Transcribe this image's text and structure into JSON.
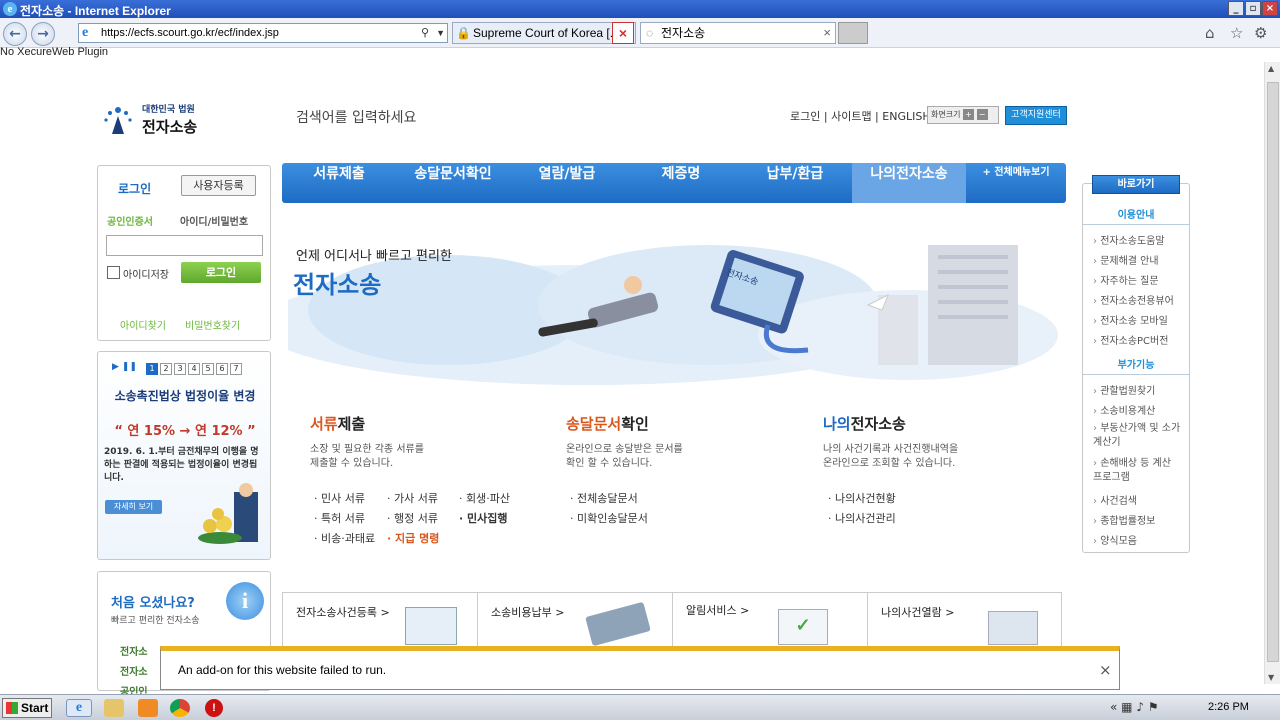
{
  "window": {
    "title": "전자소송 - Internet Explorer"
  },
  "browser": {
    "url": "https://ecfs.scourt.go.kr/ecf/index.jsp",
    "tabs": [
      {
        "label": "Supreme Court of Korea [...",
        "active": false
      },
      {
        "label": "전자소송",
        "active": true
      }
    ],
    "plugin_notice": "No XecureWeb Plugin"
  },
  "header": {
    "logo_small": "대한민국 법원",
    "logo_big": "전자소송",
    "search_placeholder": "검색어를 입력하세요",
    "util_links": [
      "로그인",
      "사이트맵",
      "ENGLISH"
    ],
    "font_size_label": "화면크기",
    "customer_center": "고객지원센터"
  },
  "nav": {
    "items": [
      "서류제출",
      "송달문서확인",
      "열람/발급",
      "제증명",
      "납부/환급",
      "나의전자소송"
    ],
    "all_menu": "+ 전체메뉴보기"
  },
  "login": {
    "title": "로그인",
    "register": "사용자등록",
    "tab_cert": "공인인증서",
    "tab_id": "아이디/비밀번호",
    "save_id": "아이디저장",
    "login_btn": "로그인",
    "find_id": "아이디찾기",
    "find_pw": "비밀번호찾기"
  },
  "banner": {
    "pages": [
      "1",
      "2",
      "3",
      "4",
      "5",
      "6",
      "7"
    ],
    "title": "소송촉진법상 법정이율 변경",
    "rate_from": "연 15%",
    "rate_to": "연 12%",
    "body": "2019. 6. 1.부터 금전채무의 이행을 명하는 판결에 적용되는 법정이율이 변경됩니다.",
    "more": "자세히 보기"
  },
  "welcome": {
    "title": "처음 오셨나요?",
    "sub": "빠르고 편리한 전자소송",
    "items": [
      "전자소",
      "전자소",
      "공인인"
    ]
  },
  "hero": {
    "line1": "언제 어디서나 빠르고 편리한",
    "line2": "전자소송",
    "sign_text": "전자소송"
  },
  "sections": [
    {
      "title_hl": "서류",
      "title_rest": "제출",
      "desc": "소장 및 필요한 각종 서류를\n제출할 수 있습니다.",
      "links": [
        "민사 서류",
        "가사 서류",
        "회생·파산",
        "특허 서류",
        "행정 서류",
        "민사집행",
        "비송·과태료",
        "지급 명령"
      ]
    },
    {
      "title_hl": "송달문서",
      "title_rest": "확인",
      "desc": "온라인으로 송달받은 문서를\n확인 할 수 있습니다.",
      "links": [
        "전체송달문서",
        "미확인송달문서"
      ]
    },
    {
      "title_hl": "나의",
      "title_rest": "전자소송",
      "desc": "나의 사건기록과 사건진행내역을\n온라인으로 조회할 수 있습니다.",
      "links": [
        "나의사건현황",
        "나의사건관리"
      ]
    }
  ],
  "quick": {
    "title": "바로가기",
    "group1": "이용안내",
    "group1_links": [
      "전자소송도움말",
      "문제해결 안내",
      "자주하는 질문",
      "전자소송전용뷰어",
      "전자소송 모바일",
      "전자소송PC버전"
    ],
    "group2": "부가기능",
    "group2_links": [
      "관할법원찾기",
      "소송비용계산",
      "부동산가액 및 소가계산기",
      "손해배상 등 계산 프로그램",
      "사건검색",
      "종합법률정보",
      "양식모음"
    ]
  },
  "bottom_tiles": [
    "전자소송사건등록 >",
    "소송비용납부 >",
    "알림서비스 >",
    "나의사건열람 >"
  ],
  "notification": {
    "text": "An add-on for this website failed to run."
  },
  "taskbar": {
    "start": "Start",
    "clock": "2:26 PM"
  },
  "colors": {
    "brand_blue": "#1e6bc4",
    "accent_orange": "#d9561c",
    "login_green": "#6cb83a"
  }
}
